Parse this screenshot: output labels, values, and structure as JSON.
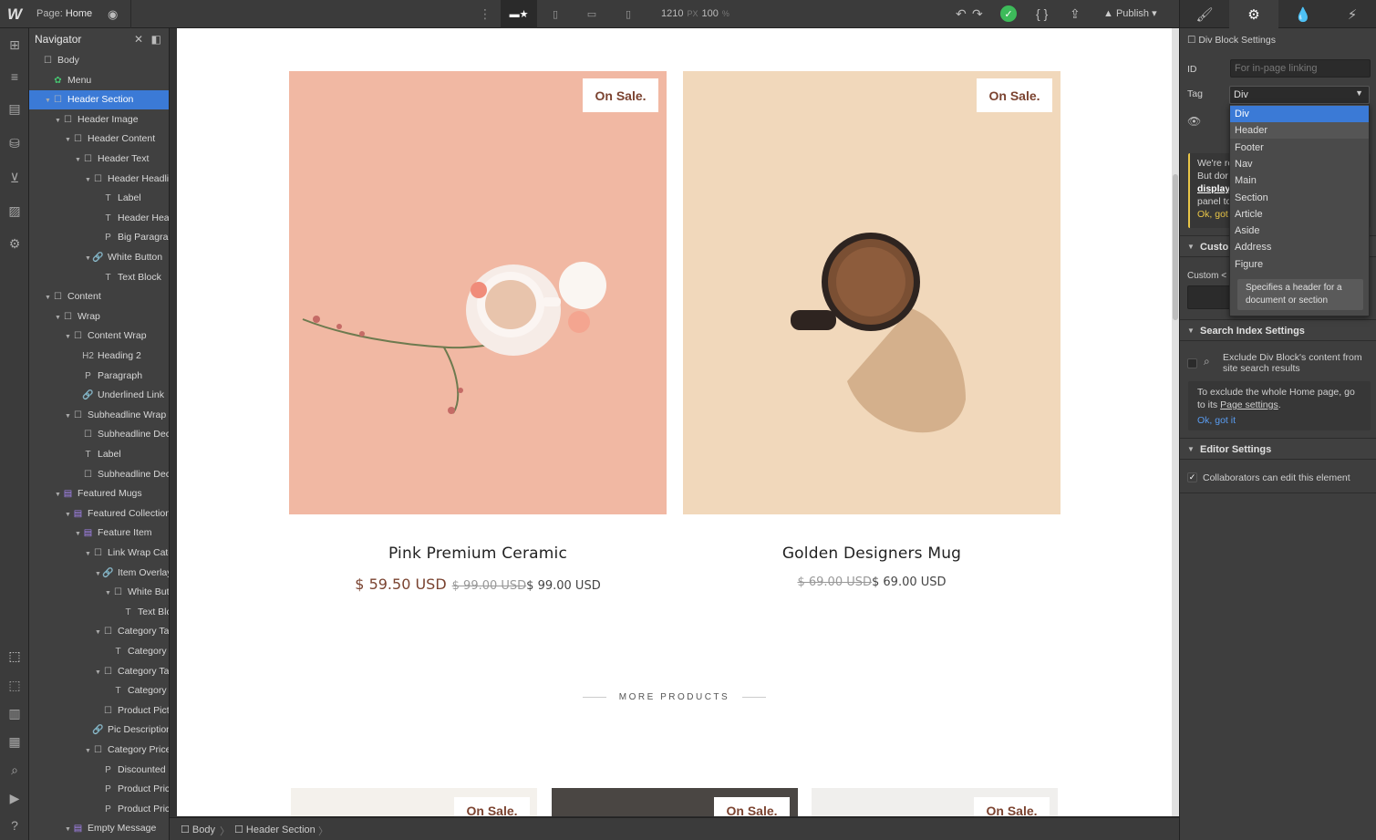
{
  "topbar": {
    "logo": "W",
    "page_prefix": "Page:",
    "page_name": "Home",
    "zoom_width": "1210",
    "zoom_width_unit": "PX",
    "zoom_percent": "100",
    "zoom_percent_unit": "%",
    "publish_label": "Publish"
  },
  "navigator": {
    "title": "Navigator",
    "items": [
      {
        "label": "Body",
        "icon": "box-icon"
      },
      {
        "label": "Menu",
        "icon": "symbol-icon"
      },
      {
        "label": "Header Section",
        "icon": "box-icon",
        "selected": true
      },
      {
        "label": "Header Image",
        "icon": "box-icon"
      },
      {
        "label": "Header Content",
        "icon": "box-icon"
      },
      {
        "label": "Header Text",
        "icon": "box-icon"
      },
      {
        "label": "Header Headline",
        "icon": "box-icon"
      },
      {
        "label": "Label",
        "icon": "text-icon"
      },
      {
        "label": "Header Headli",
        "icon": "text-icon"
      },
      {
        "label": "Big Paragraph",
        "icon": "paragraph-icon"
      },
      {
        "label": "White Button",
        "icon": "link-icon"
      },
      {
        "label": "Text Block",
        "icon": "text-icon"
      },
      {
        "label": "Content",
        "icon": "box-icon"
      },
      {
        "label": "Wrap",
        "icon": "box-icon"
      },
      {
        "label": "Content Wrap",
        "icon": "box-icon"
      },
      {
        "label": "Heading 2",
        "icon": "heading-icon"
      },
      {
        "label": "Paragraph",
        "icon": "paragraph-icon"
      },
      {
        "label": "Underlined Link",
        "icon": "link-icon"
      },
      {
        "label": "Subheadline Wrap",
        "icon": "box-icon"
      },
      {
        "label": "Subheadline Deco I",
        "icon": "box-icon"
      },
      {
        "label": "Label",
        "icon": "text-icon"
      },
      {
        "label": "Subheadline Deco I",
        "icon": "box-icon"
      },
      {
        "label": "Featured Mugs",
        "icon": "collection-icon"
      },
      {
        "label": "Featured Collection",
        "icon": "collection-icon"
      },
      {
        "label": "Feature Item",
        "icon": "collection-icon"
      },
      {
        "label": "Link Wrap Cate",
        "icon": "box-icon"
      },
      {
        "label": "Item Overlay",
        "icon": "link-icon"
      },
      {
        "label": "White But",
        "icon": "box-icon"
      },
      {
        "label": "Text Blc",
        "icon": "text-icon"
      },
      {
        "label": "Category Ta",
        "icon": "box-icon"
      },
      {
        "label": "Category",
        "icon": "text-icon"
      },
      {
        "label": "Category Ta",
        "icon": "box-icon"
      },
      {
        "label": "Category",
        "icon": "text-icon"
      },
      {
        "label": "Product Pict",
        "icon": "box-icon"
      },
      {
        "label": "Pic Description",
        "icon": "link-icon"
      },
      {
        "label": "Category Price",
        "icon": "box-icon"
      },
      {
        "label": "Discounted",
        "icon": "paragraph-icon"
      },
      {
        "label": "Product Pric",
        "icon": "paragraph-icon"
      },
      {
        "label": "Product Pric",
        "icon": "paragraph-icon"
      },
      {
        "label": "Empty Message",
        "icon": "collection-icon"
      }
    ]
  },
  "canvas": {
    "products": [
      {
        "badge": "On Sale.",
        "title": "Pink Premium Ceramic",
        "price_discounted": "$ 59.50 USD",
        "price_old": "$ 99.00 USD",
        "price": "$ 99.00 USD"
      },
      {
        "badge": "On Sale.",
        "title": "Golden Designers Mug",
        "price_old": "$ 69.00 USD",
        "price": "$ 69.00 USD"
      }
    ],
    "more_products": "MORE PRODUCTS",
    "bottom_badges": [
      "On Sale.",
      "On Sale.",
      "On Sale."
    ]
  },
  "breadcrumb": [
    "Body",
    "Header Section"
  ],
  "settings": {
    "title": "Div Block Settings",
    "id_label": "ID",
    "id_placeholder": "For in-page linking",
    "tag_label": "Tag",
    "tag_value": "Div",
    "tag_options": [
      "Div",
      "Header",
      "Footer",
      "Nav",
      "Main",
      "Section",
      "Article",
      "Aside",
      "Address",
      "Figure"
    ],
    "tag_tooltip": "Specifies a header for a document or section",
    "warn_line1": "We're re",
    "warn_line2": "But dor",
    "warn_bold": "display",
    "warn_line4": "panel to",
    "warn_link": "Ok, got",
    "custom_head": "Custo",
    "custom_label": "Custom <",
    "search_head": "Search Index Settings",
    "search_exclude": "Exclude Div Block's content from site search results",
    "search_info": "To exclude the whole Home page, go to its",
    "search_info_link": "Page settings",
    "search_info_end": ".",
    "search_ok": "Ok, got it",
    "editor_head": "Editor Settings",
    "editor_collab": "Collaborators can edit this element"
  },
  "colors": {
    "accent": "#3b7ad6",
    "sale_text": "#7b4330",
    "price_brown": "#7a4330",
    "warning": "#e8c547",
    "publish_green": "#3dbb5a"
  }
}
